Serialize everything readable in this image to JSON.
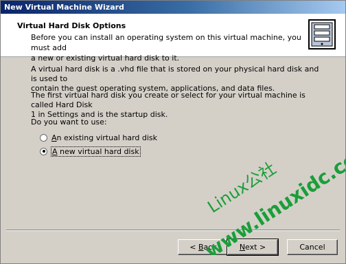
{
  "window": {
    "title": "New Virtual Machine Wizard"
  },
  "header": {
    "title": "Virtual Hard Disk Options",
    "description_line1": "Before you can install an operating system on this virtual machine, you must add",
    "description_line2": "a new or existing virtual hard disk to it.",
    "icon": "server-tower-icon"
  },
  "body": {
    "para1_line1": "A virtual hard disk is a .vhd file that is stored on your physical hard disk and is used to",
    "para1_line2": "contain the guest operating system, applications, and data files.",
    "para2_line1": "The first virtual hard disk you create or select for your virtual machine is called Hard Disk",
    "para2_line2": "1 in Settings and is the startup disk.",
    "question": "Do you want to use:",
    "options": [
      {
        "mnemonic": "A",
        "rest": "n existing virtual hard disk",
        "selected": false
      },
      {
        "mnemonic": "A",
        "rest": " new virtual hard disk",
        "selected": true
      }
    ]
  },
  "buttons": {
    "back_prefix": "< ",
    "back_mnemonic": "B",
    "back_rest": "ack",
    "next_mnemonic": "N",
    "next_rest": "ext >",
    "cancel": "Cancel"
  },
  "watermark": {
    "line1": "Linux公社",
    "line2": "www.linuxidc.com",
    "color": "#1a9e3a"
  }
}
